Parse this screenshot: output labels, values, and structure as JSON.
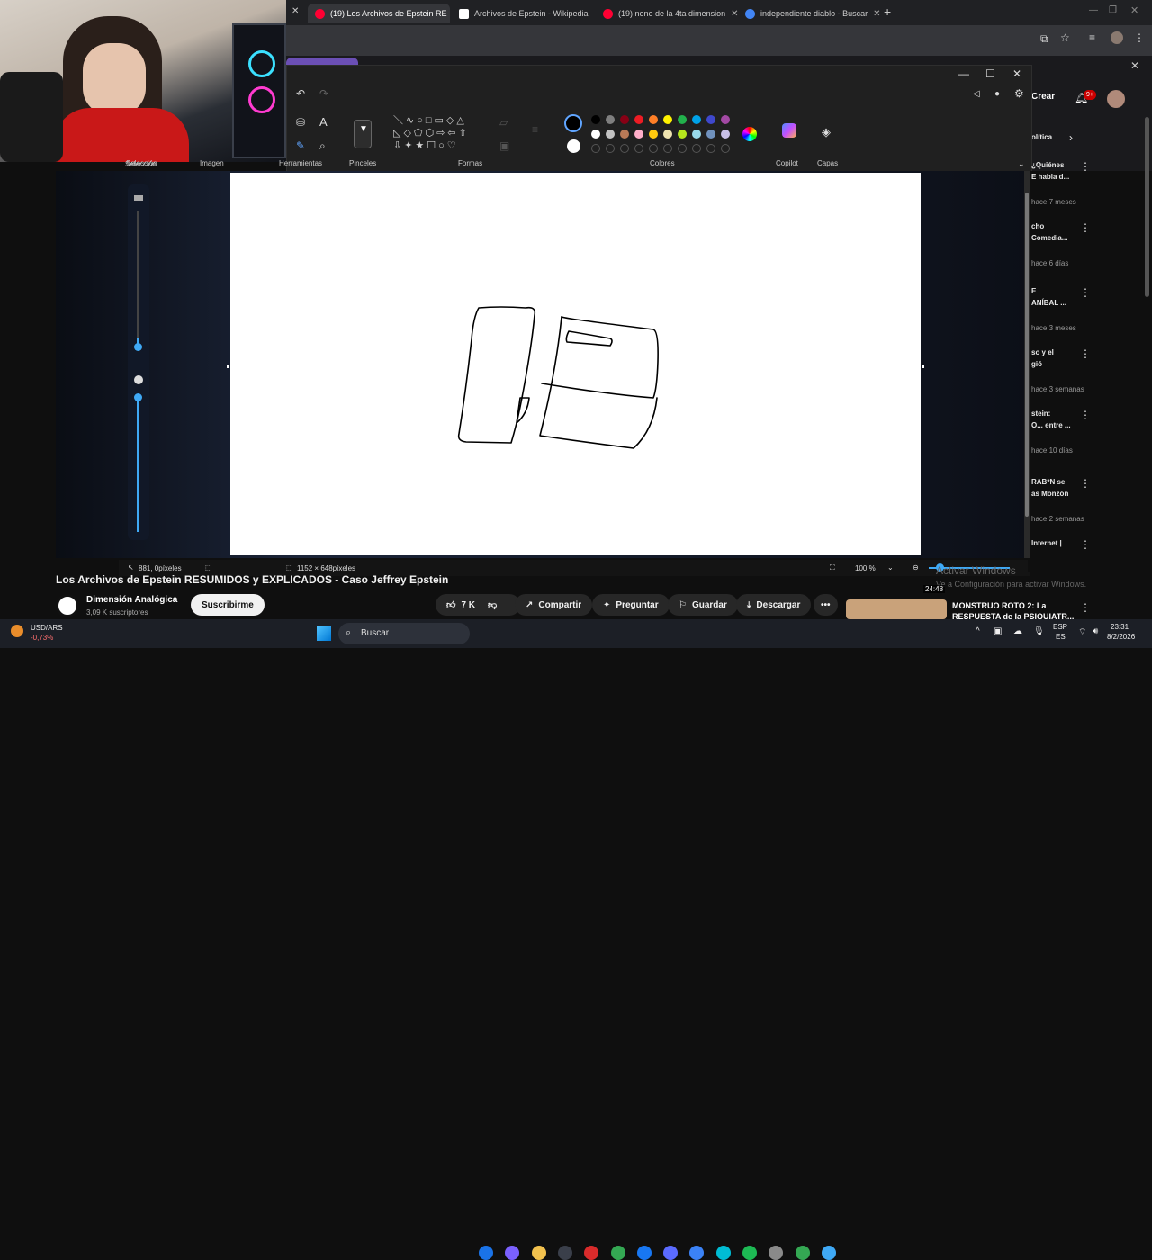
{
  "chrome": {
    "tabs": [
      {
        "label": "(19) Los Archivos de Epstein RE",
        "active": true,
        "favicon_color": "#ff0033"
      },
      {
        "label": "Archivos de Epstein - Wikipedia",
        "active": false,
        "favicon_color": "#ffffff"
      },
      {
        "label": "(19) nene de la 4ta dimension",
        "active": false,
        "favicon_color": "#ff0033"
      },
      {
        "label": "independiente diablo - Buscar",
        "active": false,
        "favicon_color": "#4285f4"
      }
    ],
    "new_tab": "+",
    "close": "×"
  },
  "youtube_header": {
    "crear": "Crear",
    "notif_badge": "9+",
    "chip": "olítica"
  },
  "paint": {
    "groups": {
      "seleccion": "Selección",
      "imagen": "Imagen",
      "herramientas": "Herramientas",
      "pinceles": "Pinceles",
      "formas": "Formas",
      "colores": "Colores",
      "copilot": "Copilot",
      "capas": "Capas"
    },
    "colors_row1": [
      "#000000",
      "#7f7f7f",
      "#880015",
      "#ed1c24",
      "#ff7f27",
      "#fff200",
      "#22b14c",
      "#00a2e8",
      "#3f48cc",
      "#a349a4"
    ],
    "colors_row2": [
      "#ffffff",
      "#c3c3c3",
      "#b97a57",
      "#ffaec9",
      "#ffc90e",
      "#efe4b0",
      "#b5e61d",
      "#99d9ea",
      "#7092be",
      "#c8bfe7"
    ],
    "primary": "#000000",
    "secondary": "#ffffff",
    "status": {
      "cursor": "881, 0píxeles",
      "size": "1152 × 648píxeles",
      "zoom": "100 %"
    }
  },
  "sidebar": [
    {
      "title1": "¿Quiénes",
      "title2": "E habla d...",
      "meta": "hace 7 meses"
    },
    {
      "title1": "cho",
      "title2": "Comedia...",
      "meta": "hace 6 días"
    },
    {
      "title1": "E",
      "title2": "ANÍBAL ...",
      "meta": "hace 3 meses"
    },
    {
      "title1": "so y el",
      "title2": "gió",
      "meta": "hace 3 semanas"
    },
    {
      "title1": "stein:",
      "title2": "O... entre ...",
      "meta": "hace 10 días"
    },
    {
      "title1": "RAB*N se",
      "title2": "as Monzón",
      "meta": "hace 2 semanas"
    },
    {
      "title1": "Internet |",
      "title2": "",
      "meta": ""
    }
  ],
  "video": {
    "title": "Los Archivos de Epstein RESUMIDOS y EXPLICADOS - Caso Jeffrey Epstein",
    "channel": "Dimensión Analógica",
    "subs": "3,09 K suscriptores",
    "subscribe": "Suscribirme",
    "likes": "7 K",
    "share": "Compartir",
    "ask": "Preguntar",
    "save": "Guardar",
    "download": "Descargar",
    "next_title": "MONSTRUO ROTO 2: La",
    "next_title2": "RESPUESTA de la PSIQUIATR...",
    "next_duration": "24:48"
  },
  "watermark": {
    "line1": "Activar Windows",
    "line2": "Ve a Configuración para activar Windows."
  },
  "taskbar": {
    "ticker": "USD/ARS",
    "ticker_change": "-0,73%",
    "search": "Buscar",
    "lang1": "ESP",
    "lang2": "ES",
    "time": "23:31",
    "date": "8/2/2026"
  }
}
